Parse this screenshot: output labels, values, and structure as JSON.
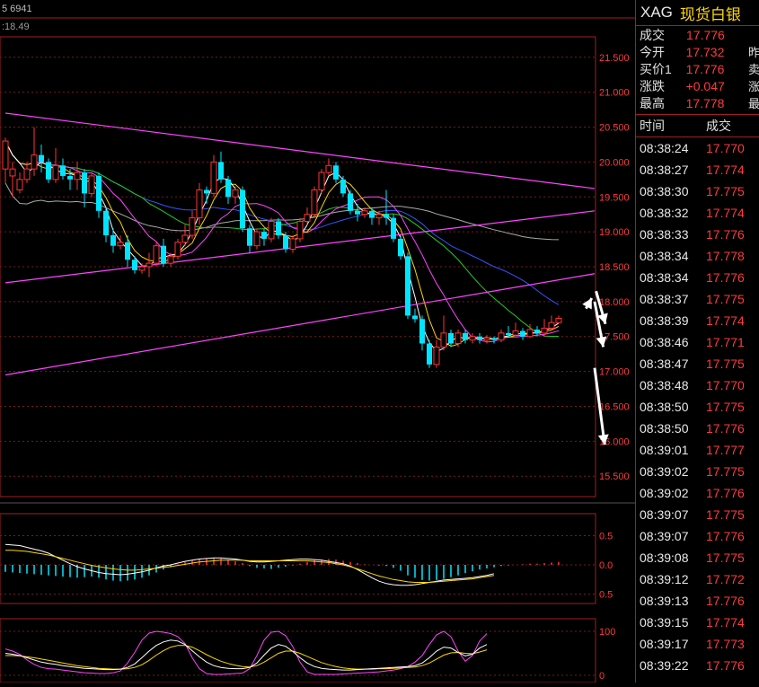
{
  "header": {
    "legend1": "5 6941",
    "legend2": ":18.49"
  },
  "colors": {
    "up": "#ff3333",
    "down": "#00e5ff",
    "ma1": "#ffffff",
    "ma2": "#ffd700",
    "ma3": "#ff44ff",
    "ma4": "#22cc22",
    "ma5": "#3355ff",
    "ma6": "#aaaaaa",
    "trendline": "#ff44ff"
  },
  "chart_data": [
    {
      "type": "line",
      "name": "main",
      "y_ticks": [
        "21.500",
        "21.000",
        "20.500",
        "20.000",
        "19.500",
        "19.000",
        "18.500",
        "18.000",
        "17.500",
        "17.000",
        "16.500",
        "16.000",
        "15.500"
      ],
      "ylim": [
        15.4,
        21.6
      ],
      "candles": [
        [
          19.9,
          20.3,
          19.7,
          20.35
        ],
        [
          19.8,
          19.9,
          19.5,
          20.0
        ],
        [
          19.6,
          19.75,
          19.55,
          19.85
        ],
        [
          19.75,
          19.9,
          19.7,
          20.0
        ],
        [
          19.9,
          20.1,
          19.8,
          20.5
        ],
        [
          20.1,
          20.0,
          19.85,
          20.25
        ],
        [
          20.0,
          19.75,
          19.7,
          20.05
        ],
        [
          19.75,
          19.95,
          19.7,
          20.2
        ],
        [
          19.95,
          19.8,
          19.75,
          20.05
        ],
        [
          19.8,
          19.75,
          19.6,
          19.9
        ],
        [
          19.75,
          19.85,
          19.6,
          20.0
        ],
        [
          19.85,
          19.55,
          19.35,
          19.9
        ],
        [
          19.55,
          19.8,
          19.5,
          19.85
        ],
        [
          19.8,
          19.3,
          19.2,
          19.85
        ],
        [
          19.3,
          18.95,
          18.85,
          19.35
        ],
        [
          18.95,
          18.8,
          18.7,
          19.05
        ],
        [
          18.8,
          18.85,
          18.75,
          18.95
        ],
        [
          18.85,
          18.6,
          18.5,
          18.95
        ],
        [
          18.6,
          18.45,
          18.4,
          18.65
        ],
        [
          18.45,
          18.5,
          18.4,
          18.55
        ],
        [
          18.5,
          18.55,
          18.35,
          18.7
        ],
        [
          18.55,
          18.8,
          18.5,
          18.85
        ],
        [
          18.8,
          18.55,
          18.5,
          18.9
        ],
        [
          18.55,
          18.65,
          18.5,
          18.7
        ],
        [
          18.65,
          18.85,
          18.6,
          18.9
        ],
        [
          18.85,
          18.95,
          18.8,
          19.1
        ],
        [
          18.95,
          19.2,
          18.9,
          19.3
        ],
        [
          19.2,
          19.6,
          19.1,
          19.7
        ],
        [
          19.6,
          19.55,
          19.4,
          19.65
        ],
        [
          19.55,
          20.0,
          19.5,
          20.1
        ],
        [
          20.0,
          19.75,
          19.7,
          20.15
        ],
        [
          19.75,
          19.5,
          19.4,
          19.8
        ],
        [
          19.5,
          19.6,
          19.4,
          19.65
        ],
        [
          19.6,
          19.05,
          19.0,
          19.65
        ],
        [
          19.05,
          18.8,
          18.7,
          19.1
        ],
        [
          18.8,
          19.0,
          18.75,
          19.05
        ],
        [
          19.0,
          18.9,
          18.8,
          19.05
        ],
        [
          18.9,
          19.15,
          18.85,
          19.2
        ],
        [
          19.15,
          18.95,
          18.9,
          19.2
        ],
        [
          18.95,
          18.75,
          18.7,
          19.0
        ],
        [
          18.75,
          18.9,
          18.7,
          18.95
        ],
        [
          18.9,
          19.15,
          18.85,
          19.2
        ],
        [
          19.15,
          19.25,
          19.1,
          19.35
        ],
        [
          19.25,
          19.6,
          19.2,
          19.65
        ],
        [
          19.6,
          19.85,
          19.55,
          19.9
        ],
        [
          19.85,
          19.95,
          19.8,
          20.05
        ],
        [
          19.95,
          19.75,
          19.7,
          20.0
        ],
        [
          19.75,
          19.55,
          19.5,
          19.8
        ],
        [
          19.55,
          19.3,
          19.25,
          19.6
        ],
        [
          19.3,
          19.25,
          19.15,
          19.4
        ],
        [
          19.25,
          19.3,
          19.2,
          19.35
        ],
        [
          19.3,
          19.2,
          19.1,
          19.35
        ],
        [
          19.2,
          19.25,
          19.1,
          19.3
        ],
        [
          19.25,
          19.2,
          19.1,
          19.6
        ],
        [
          19.2,
          18.9,
          18.85,
          19.25
        ],
        [
          18.9,
          18.65,
          18.6,
          18.95
        ],
        [
          18.65,
          17.8,
          17.75,
          18.7
        ],
        [
          17.8,
          17.75,
          17.7,
          17.9
        ],
        [
          17.75,
          17.4,
          17.3,
          17.8
        ],
        [
          17.4,
          17.1,
          17.05,
          17.45
        ],
        [
          17.1,
          17.35,
          17.05,
          17.45
        ],
        [
          17.35,
          17.55,
          17.3,
          17.8
        ],
        [
          17.55,
          17.4,
          17.35,
          17.6
        ],
        [
          17.4,
          17.55,
          17.35,
          17.6
        ],
        [
          17.55,
          17.45,
          17.4,
          17.6
        ],
        [
          17.45,
          17.5,
          17.4,
          17.55
        ],
        [
          17.5,
          17.45,
          17.4,
          17.55
        ],
        [
          17.45,
          17.48,
          17.4,
          17.52
        ],
        [
          17.48,
          17.45,
          17.4,
          17.5
        ],
        [
          17.45,
          17.55,
          17.42,
          17.6
        ],
        [
          17.55,
          17.52,
          17.48,
          17.65
        ],
        [
          17.52,
          17.58,
          17.5,
          17.7
        ],
        [
          17.58,
          17.5,
          17.45,
          17.62
        ],
        [
          17.5,
          17.6,
          17.48,
          17.68
        ],
        [
          17.6,
          17.55,
          17.5,
          17.65
        ],
        [
          17.55,
          17.62,
          17.5,
          17.75
        ],
        [
          17.62,
          17.7,
          17.6,
          17.8
        ],
        [
          17.7,
          17.76,
          17.68,
          17.8
        ]
      ],
      "trendlines": [
        {
          "from": [
            0,
            20.7
          ],
          "to": [
            82,
            19.62
          ]
        },
        {
          "from": [
            0,
            18.27
          ],
          "to": [
            82,
            19.3
          ]
        },
        {
          "from": [
            0,
            16.95
          ],
          "to": [
            82,
            18.4
          ]
        }
      ],
      "arrows": [
        {
          "from": [
            80.8,
            17.9
          ],
          "to": [
            81.6,
            18.05
          ]
        },
        {
          "from": [
            82.2,
            18.15
          ],
          "to": [
            83.5,
            17.68
          ]
        },
        {
          "from": [
            82.0,
            18.0
          ],
          "to": [
            83.2,
            17.35
          ]
        },
        {
          "from": [
            82.0,
            17.05
          ],
          "to": [
            83.4,
            15.95
          ]
        }
      ]
    },
    {
      "type": "bar",
      "name": "macd",
      "y_ticks": [
        "0.5",
        "0.0",
        "0.5"
      ],
      "ylim": [
        -0.6,
        0.6
      ],
      "hist": [
        -0.12,
        -0.13,
        -0.14,
        -0.15,
        -0.16,
        -0.17,
        -0.18,
        -0.19,
        -0.2,
        -0.21,
        -0.22,
        -0.21,
        -0.2,
        -0.22,
        -0.25,
        -0.27,
        -0.28,
        -0.27,
        -0.25,
        -0.22,
        -0.18,
        -0.13,
        -0.08,
        -0.04,
        0.01,
        0.05,
        0.08,
        0.1,
        0.11,
        0.12,
        0.11,
        0.09,
        0.06,
        0.03,
        -0.02,
        -0.05,
        -0.06,
        -0.07,
        -0.05,
        -0.03,
        -0.01,
        0.02,
        0.05,
        0.08,
        0.09,
        0.1,
        0.09,
        0.07,
        0.05,
        0.03,
        0.01,
        0.0,
        -0.01,
        -0.02,
        -0.05,
        -0.1,
        -0.18,
        -0.22,
        -0.26,
        -0.27,
        -0.26,
        -0.24,
        -0.21,
        -0.18,
        -0.14,
        -0.11,
        -0.08,
        -0.06,
        -0.04,
        -0.02,
        -0.01,
        0.0,
        0.01,
        0.02,
        0.02,
        0.03,
        0.04,
        0.05
      ],
      "dif": [
        0.35,
        0.34,
        0.33,
        0.3,
        0.27,
        0.24,
        0.2,
        0.14,
        0.08,
        0.02,
        -0.03,
        -0.07,
        -0.1,
        -0.13,
        -0.15,
        -0.16,
        -0.17,
        -0.16,
        -0.14,
        -0.12,
        -0.09,
        -0.05,
        -0.02,
        0.0,
        0.03,
        0.06,
        0.08,
        0.1,
        0.11,
        0.12,
        0.12,
        0.11,
        0.1,
        0.08,
        0.06,
        0.05,
        0.05,
        0.06,
        0.07,
        0.08,
        0.09,
        0.1,
        0.1,
        0.09,
        0.08,
        0.06,
        0.04,
        0.02,
        -0.02,
        -0.08,
        -0.15,
        -0.22,
        -0.28,
        -0.32,
        -0.34,
        -0.35,
        -0.35,
        -0.34,
        -0.32,
        -0.3,
        -0.28,
        -0.26,
        -0.25,
        -0.24,
        -0.23,
        -0.22,
        -0.2,
        -0.18,
        -0.15
      ],
      "dea": [
        0.25,
        0.25,
        0.24,
        0.23,
        0.21,
        0.19,
        0.17,
        0.14,
        0.11,
        0.08,
        0.05,
        0.02,
        -0.01,
        -0.03,
        -0.05,
        -0.07,
        -0.08,
        -0.09,
        -0.09,
        -0.08,
        -0.07,
        -0.06,
        -0.04,
        -0.03,
        -0.01,
        0.01,
        0.03,
        0.05,
        0.06,
        0.07,
        0.08,
        0.08,
        0.08,
        0.08,
        0.07,
        0.07,
        0.07,
        0.07,
        0.07,
        0.07,
        0.07,
        0.07,
        0.07,
        0.06,
        0.05,
        0.04,
        0.02,
        0.0,
        -0.03,
        -0.07,
        -0.11,
        -0.15,
        -0.19,
        -0.22,
        -0.25,
        -0.27,
        -0.29,
        -0.3,
        -0.3,
        -0.3,
        -0.29,
        -0.28,
        -0.27,
        -0.26,
        -0.25,
        -0.24,
        -0.22,
        -0.2,
        -0.18
      ]
    },
    {
      "type": "line",
      "name": "kdj",
      "y_ticks": [
        "100",
        "0"
      ],
      "ylim": [
        0,
        100
      ],
      "k": [
        50,
        48,
        45,
        40,
        35,
        30,
        27,
        25,
        22,
        20,
        18,
        16,
        15,
        14,
        13,
        13,
        14,
        18,
        26,
        40,
        55,
        68,
        76,
        80,
        78,
        70,
        56,
        42,
        30,
        22,
        18,
        16,
        15,
        15,
        18,
        28,
        46,
        62,
        70,
        66,
        54,
        40,
        28,
        20,
        16,
        14,
        13,
        12,
        12,
        13,
        14,
        15,
        16,
        17,
        18,
        19,
        20,
        22,
        28,
        40,
        55,
        64,
        62,
        52,
        44,
        48,
        62,
        70
      ],
      "d": [
        45,
        45,
        44,
        42,
        40,
        37,
        34,
        31,
        28,
        25,
        22,
        20,
        18,
        16,
        15,
        14,
        14,
        15,
        18,
        24,
        34,
        46,
        56,
        64,
        68,
        68,
        64,
        56,
        47,
        39,
        32,
        27,
        23,
        20,
        19,
        22,
        30,
        40,
        50,
        55,
        55,
        50,
        43,
        36,
        29,
        24,
        20,
        17,
        15,
        14,
        14,
        14,
        15,
        15,
        16,
        17,
        18,
        19,
        22,
        28,
        37,
        46,
        51,
        52,
        50,
        49,
        53,
        58
      ],
      "j": [
        60,
        55,
        48,
        35,
        25,
        18,
        15,
        14,
        12,
        10,
        8,
        6,
        5,
        4,
        4,
        6,
        10,
        28,
        52,
        80,
        96,
        100,
        98,
        95,
        88,
        72,
        40,
        15,
        4,
        2,
        2,
        3,
        4,
        5,
        15,
        45,
        80,
        98,
        100,
        90,
        65,
        30,
        8,
        2,
        2,
        2,
        2,
        3,
        4,
        5,
        6,
        7,
        8,
        10,
        12,
        15,
        20,
        30,
        45,
        70,
        92,
        100,
        88,
        55,
        32,
        45,
        78,
        95
      ]
    }
  ],
  "quote": {
    "symbol": "XAG",
    "name": "现货白银",
    "rows": [
      {
        "label": "成交",
        "value": "17.776",
        "extra": ""
      },
      {
        "label": "今开",
        "value": "17.732",
        "extra": "昨"
      },
      {
        "label": "买价1",
        "value": "17.776",
        "extra": "卖"
      },
      {
        "label": "涨跌",
        "value": "+0.047",
        "extra": "涨"
      },
      {
        "label": "最高",
        "value": "17.778",
        "extra": "最"
      }
    ],
    "col_time": "时间",
    "col_price": "成交",
    "ticks": [
      {
        "t": "08:38:24",
        "p": "17.770"
      },
      {
        "t": "08:38:27",
        "p": "17.774"
      },
      {
        "t": "08:38:30",
        "p": "17.775"
      },
      {
        "t": "08:38:32",
        "p": "17.774"
      },
      {
        "t": "08:38:33",
        "p": "17.776"
      },
      {
        "t": "08:38:34",
        "p": "17.778"
      },
      {
        "t": "08:38:34",
        "p": "17.776"
      },
      {
        "t": "08:38:37",
        "p": "17.775"
      },
      {
        "t": "08:38:39",
        "p": "17.774"
      },
      {
        "t": "08:38:46",
        "p": "17.771"
      },
      {
        "t": "08:38:47",
        "p": "17.775"
      },
      {
        "t": "08:38:48",
        "p": "17.770"
      },
      {
        "t": "08:38:50",
        "p": "17.775"
      },
      {
        "t": "08:38:50",
        "p": "17.776"
      },
      {
        "t": "08:39:01",
        "p": "17.777"
      },
      {
        "t": "08:39:02",
        "p": "17.775"
      },
      {
        "t": "08:39:02",
        "p": "17.776"
      },
      {
        "t": "08:39:07",
        "p": "17.775"
      },
      {
        "t": "08:39:07",
        "p": "17.776"
      },
      {
        "t": "08:39:08",
        "p": "17.775"
      },
      {
        "t": "08:39:12",
        "p": "17.772"
      },
      {
        "t": "08:39:13",
        "p": "17.776"
      },
      {
        "t": "08:39:15",
        "p": "17.774"
      },
      {
        "t": "08:39:17",
        "p": "17.773"
      },
      {
        "t": "08:39:22",
        "p": "17.776"
      }
    ]
  }
}
